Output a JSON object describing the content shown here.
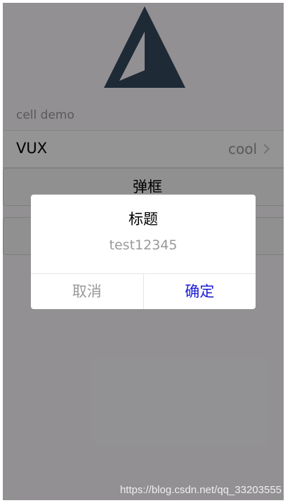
{
  "app": {
    "logo_icon": "vux-logo-icon"
  },
  "group": {
    "title": "cell demo"
  },
  "cell": {
    "title": "VUX",
    "value": "cool",
    "arrow_icon": "chevron-right-icon"
  },
  "buttons": {
    "alert_label": "弹框",
    "second_label": ""
  },
  "dialog": {
    "title": "标题",
    "content": "test12345",
    "cancel_label": "取消",
    "confirm_label": "确定",
    "confirm_color": "#1a1ad6"
  },
  "overlay": {
    "color": "rgba(0,0,0,0.42)"
  },
  "watermark": {
    "text": "https://blog.csdn.net/qq_33203555"
  }
}
